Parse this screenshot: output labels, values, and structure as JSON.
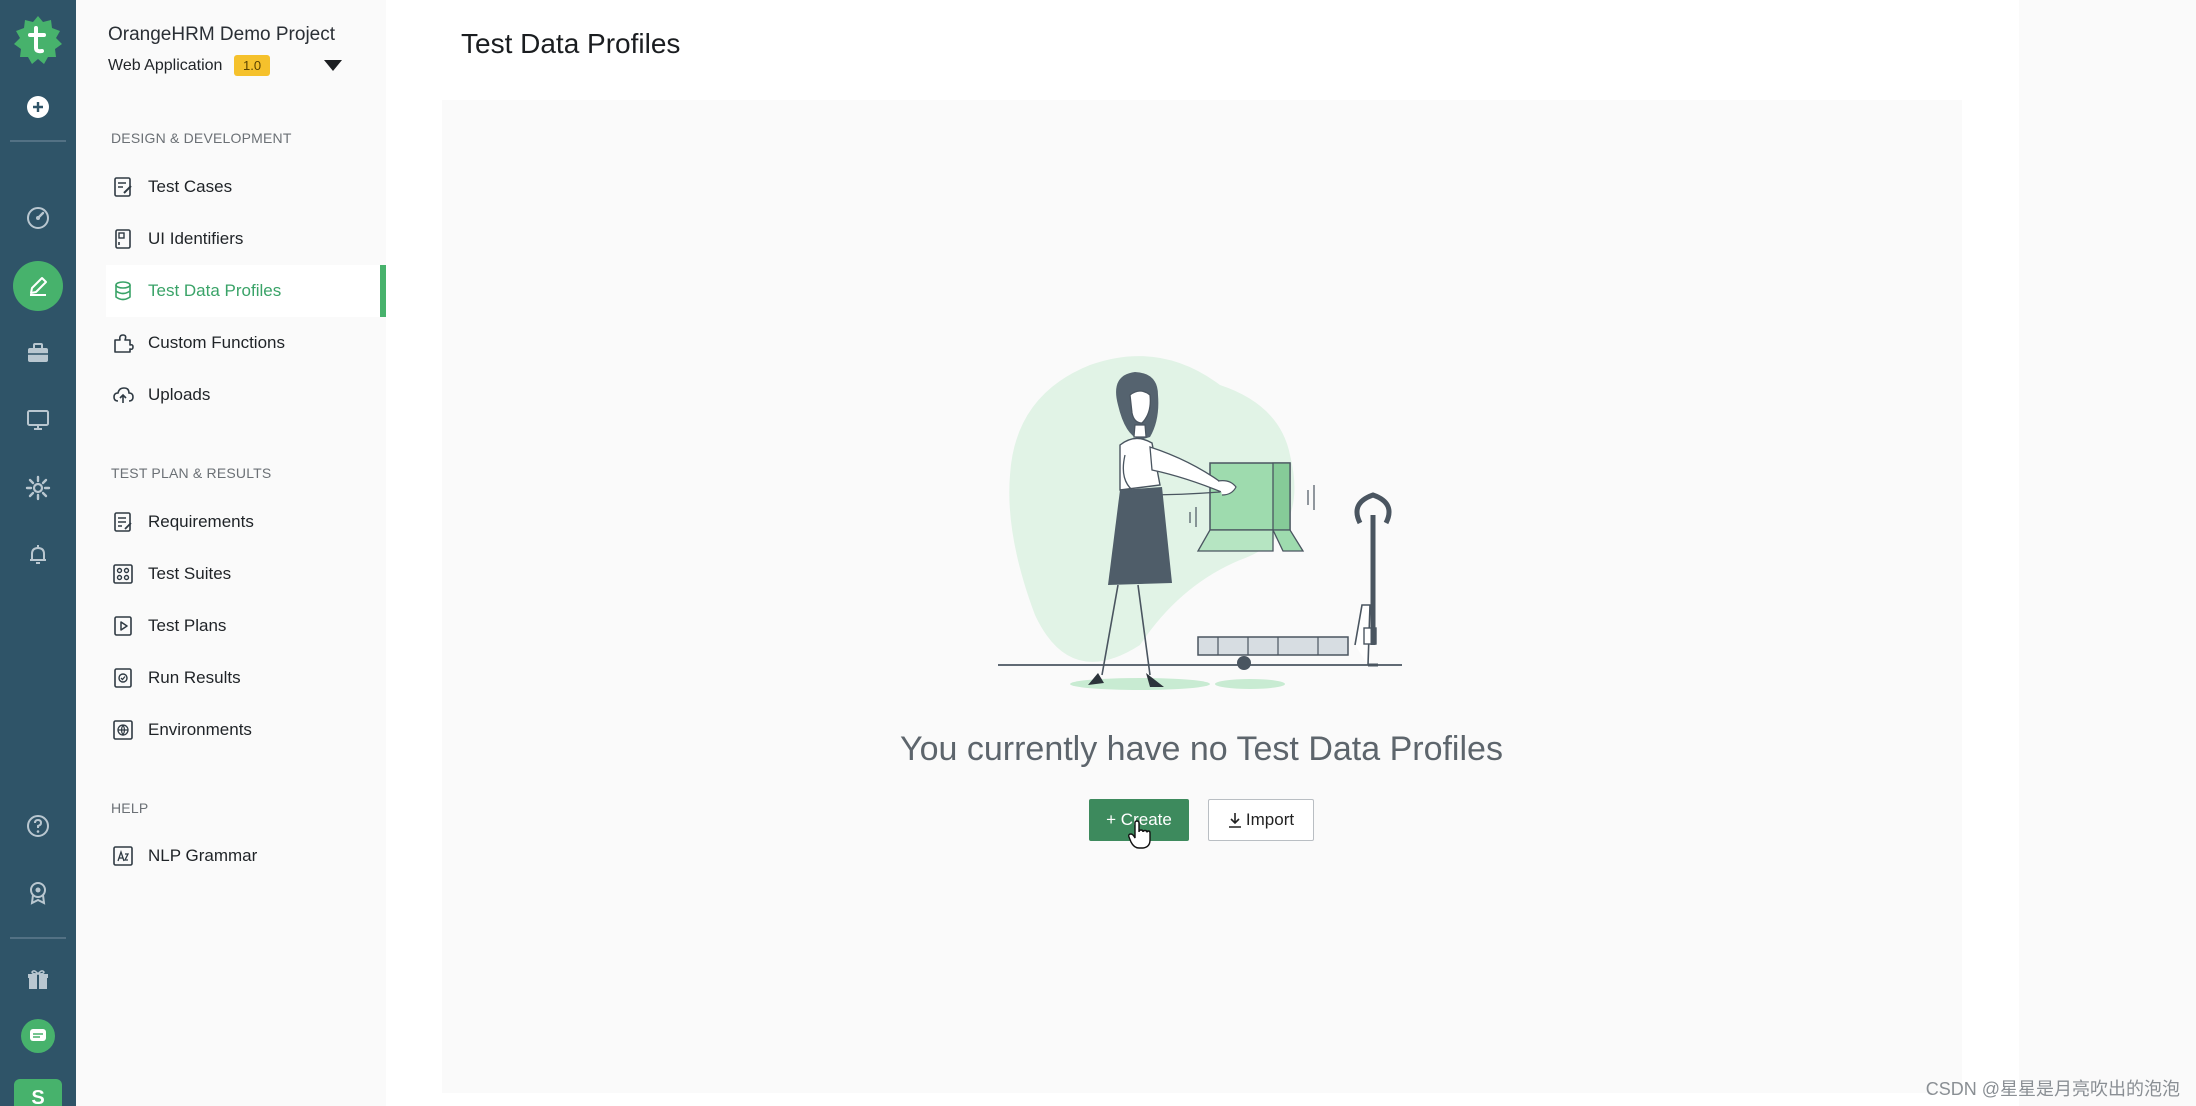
{
  "project": {
    "name": "OrangeHRM Demo Project",
    "app": "Web Application",
    "version": "1.0"
  },
  "rail": {
    "avatar_letter": "S",
    "accent": "#47b26c",
    "background": "#2f5468"
  },
  "sections": {
    "design": "DESIGN & DEVELOPMENT",
    "plan": "TEST PLAN & RESULTS",
    "help": "HELP"
  },
  "nav": {
    "test_cases": "Test Cases",
    "ui_identifiers": "UI Identifiers",
    "test_data_profiles": "Test Data Profiles",
    "custom_functions": "Custom Functions",
    "uploads": "Uploads",
    "requirements": "Requirements",
    "test_suites": "Test Suites",
    "test_plans": "Test Plans",
    "run_results": "Run Results",
    "environments": "Environments",
    "nlp_grammar": "NLP Grammar"
  },
  "main": {
    "title": "Test Data Profiles",
    "empty_message": "You currently have no Test Data Profiles",
    "create_label": "+ Create",
    "import_label": "Import"
  },
  "watermark": "CSDN @星星是月亮吹出的泡泡"
}
